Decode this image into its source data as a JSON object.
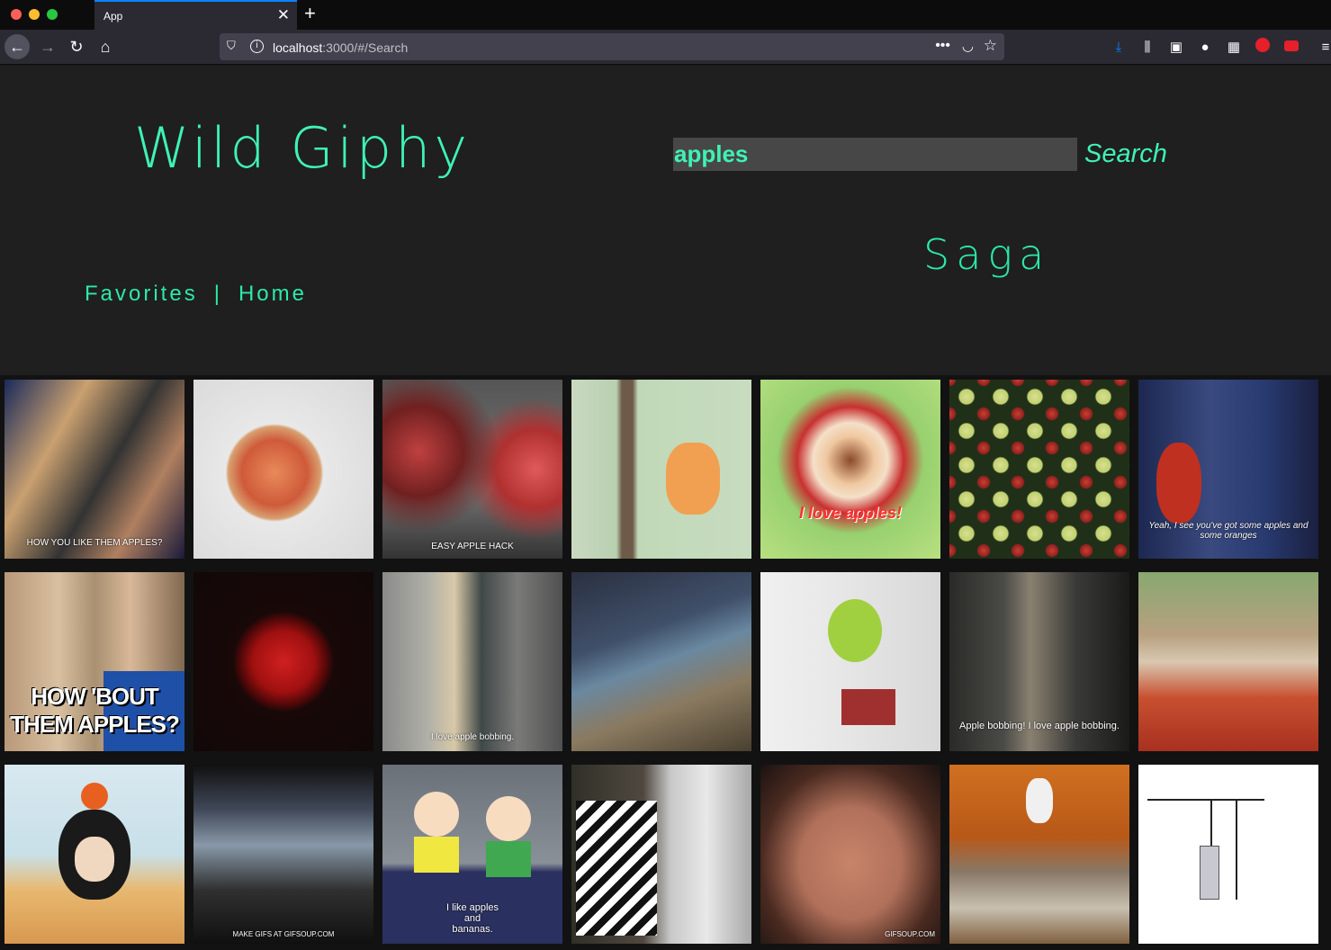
{
  "browser": {
    "tab_title": "App",
    "close_glyph": "✕",
    "new_tab_glyph": "+",
    "url_host": "localhost",
    "url_rest": ":3000/#/Search"
  },
  "header": {
    "logo": "Wild Giphy",
    "search_value": "apples",
    "search_button": "Search",
    "section_title": "Saga",
    "nav": {
      "favorites": "Favorites",
      "separator": "|",
      "home": "Home"
    }
  },
  "gifs": [
    {
      "caption": "HOW YOU LIKE THEM APPLES?"
    },
    {
      "caption": ""
    },
    {
      "caption": "EASY APPLE HACK"
    },
    {
      "caption": ""
    },
    {
      "caption": "I love apples!"
    },
    {
      "caption": ""
    },
    {
      "caption": "Yeah, I see you've got some apples and some oranges"
    },
    {
      "caption": "HOW 'BOUT THEM APPLES?"
    },
    {
      "caption": ""
    },
    {
      "caption": "I love apple bobbing."
    },
    {
      "caption": ""
    },
    {
      "caption": ""
    },
    {
      "caption": "Apple bobbing! I love apple bobbing."
    },
    {
      "caption": ""
    },
    {
      "caption": ""
    },
    {
      "caption": "MAKE GIFS AT GIFSOUP.COM"
    },
    {
      "caption": "I like apples and bananas."
    },
    {
      "caption": ""
    },
    {
      "caption": "GIFSOUP.COM"
    },
    {
      "caption": ""
    },
    {
      "caption": ""
    }
  ],
  "colors": {
    "accent": "#3ff2b4",
    "background": "#1f1f1f"
  }
}
